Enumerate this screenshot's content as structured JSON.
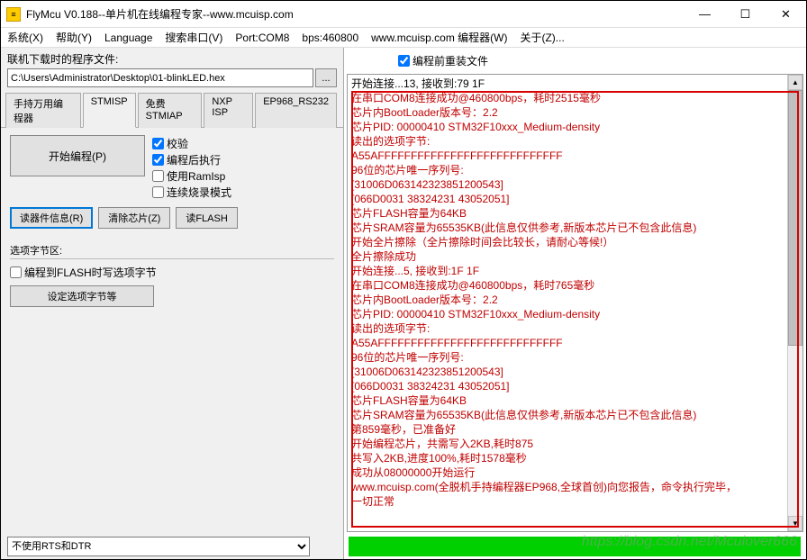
{
  "window": {
    "icon_letter": "≡",
    "title": "FlyMcu V0.188--单片机在线编程专家--www.mcuisp.com",
    "min": "—",
    "max": "☐",
    "close": "✕"
  },
  "menu": {
    "items": [
      "系统(X)",
      "帮助(Y)",
      "Language",
      "搜索串口(V)",
      "Port:COM8",
      "bps:460800",
      "www.mcuisp.com 编程器(W)",
      "关于(Z)..."
    ]
  },
  "left": {
    "path_label": "联机下载时的程序文件:",
    "path_value": "C:\\Users\\Administrator\\Desktop\\01-blinkLED.hex",
    "browse": "...",
    "tabs": [
      "手持万用编程器",
      "STMISP",
      "免费STMIAP",
      "NXP ISP",
      "EP968_RS232"
    ],
    "active_tab": 1,
    "start_button": "开始编程(P)",
    "checks": [
      {
        "label": "校验",
        "checked": true
      },
      {
        "label": "编程后执行",
        "checked": true
      },
      {
        "label": "使用RamIsp",
        "checked": false
      },
      {
        "label": "连续烧录模式",
        "checked": false
      }
    ],
    "btn_read": "读器件信息(R)",
    "btn_erase": "清除芯片(Z)",
    "btn_flash": "读FLASH",
    "section_label": "选项字节区:",
    "opt_check": {
      "label": "编程到FLASH时写选项字节",
      "checked": false
    },
    "opt_button": "设定选项字节等",
    "dtr_select": "不使用RTS和DTR"
  },
  "right": {
    "reload_checkbox": {
      "label": "编程前重装文件",
      "checked": true
    }
  },
  "log": [
    {
      "cls": "blk",
      "t": "开始连接...13, 接收到:79 1F"
    },
    {
      "cls": "red",
      "t": "在串口COM8连接成功@460800bps，耗时2515毫秒"
    },
    {
      "cls": "red",
      "t": "芯片内BootLoader版本号：2.2"
    },
    {
      "cls": "red",
      "t": "芯片PID: 00000410  STM32F10xxx_Medium-density"
    },
    {
      "cls": "red",
      "t": "读出的选项字节:"
    },
    {
      "cls": "red",
      "t": "A55AFFFFFFFFFFFFFFFFFFFFFFFFFFFF"
    },
    {
      "cls": "red",
      "t": "96位的芯片唯一序列号:"
    },
    {
      "cls": "red",
      "t": "[31006D063142323851200543]"
    },
    {
      "cls": "red",
      "t": "[066D0031 38324231 43052051]"
    },
    {
      "cls": "red",
      "t": "芯片FLASH容量为64KB"
    },
    {
      "cls": "red",
      "t": "芯片SRAM容量为65535KB(此信息仅供参考,新版本芯片已不包含此信息)"
    },
    {
      "cls": "red",
      "t": "开始全片擦除（全片擦除时间会比较长，请耐心等候!）"
    },
    {
      "cls": "red",
      "t": "全片擦除成功"
    },
    {
      "cls": "red",
      "t": "开始连接...5, 接收到:1F 1F"
    },
    {
      "cls": "red",
      "t": "在串口COM8连接成功@460800bps，耗时765毫秒"
    },
    {
      "cls": "red",
      "t": "芯片内BootLoader版本号：2.2"
    },
    {
      "cls": "red",
      "t": "芯片PID: 00000410  STM32F10xxx_Medium-density"
    },
    {
      "cls": "red",
      "t": "读出的选项字节:"
    },
    {
      "cls": "red",
      "t": "A55AFFFFFFFFFFFFFFFFFFFFFFFFFFFF"
    },
    {
      "cls": "red",
      "t": "96位的芯片唯一序列号:"
    },
    {
      "cls": "red",
      "t": "[31006D063142323851200543]"
    },
    {
      "cls": "red",
      "t": "[066D0031 38324231 43052051]"
    },
    {
      "cls": "red",
      "t": "芯片FLASH容量为64KB"
    },
    {
      "cls": "red",
      "t": "芯片SRAM容量为65535KB(此信息仅供参考,新版本芯片已不包含此信息)"
    },
    {
      "cls": "red",
      "t": "第859毫秒，已准备好"
    },
    {
      "cls": "red",
      "t": "开始编程芯片，共需写入2KB,耗时875"
    },
    {
      "cls": "red",
      "t": "共写入2KB,进度100%,耗时1578毫秒"
    },
    {
      "cls": "red",
      "t": "成功从08000000开始运行"
    },
    {
      "cls": "red",
      "t": "www.mcuisp.com(全脱机手持编程器EP968,全球首创)向您报告，命令执行完毕，"
    },
    {
      "cls": "red",
      "t": "一切正常"
    }
  ],
  "watermark": "https://blog.csdn.net/Mculover666"
}
